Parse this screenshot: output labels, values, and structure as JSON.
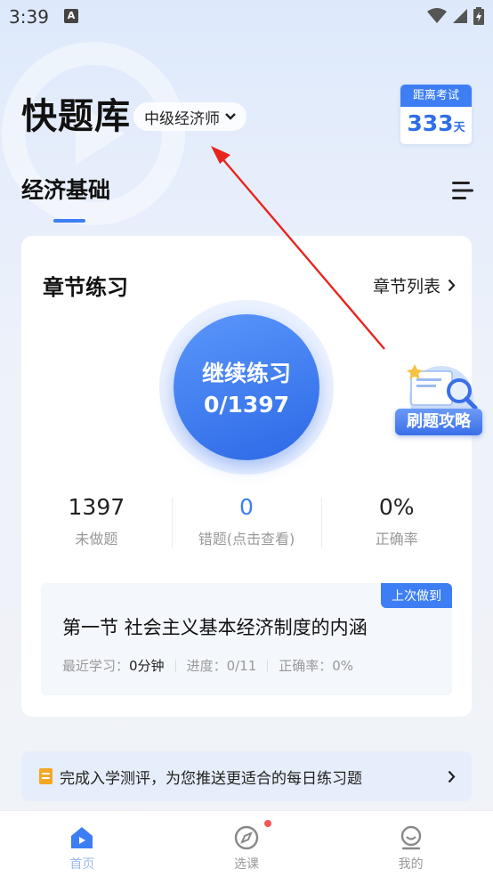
{
  "status": {
    "time": "3:39",
    "app_icon": "A"
  },
  "header": {
    "app_title": "快题库",
    "level": "中级经济师",
    "exam_label": "距离考试",
    "exam_days": "333",
    "exam_unit": "天"
  },
  "subject_tab": "经济基础",
  "chapter": {
    "title": "章节练习",
    "list_link": "章节列表",
    "continue_label": "继续练习",
    "progress": "0/1397",
    "stats": [
      {
        "value": "1397",
        "label": "未做题"
      },
      {
        "value": "0",
        "label": "错题(点击查看)"
      },
      {
        "value": "0%",
        "label": "正确率"
      }
    ],
    "last": {
      "tag": "上次做到",
      "title": "第一节 社会主义基本经济制度的内涵",
      "study_label": "最近学习：",
      "study_value": "0分钟",
      "progress": "进度：0/11",
      "accuracy": "正确率：0%"
    }
  },
  "float_guide": "刷题攻略",
  "banner": {
    "text": "完成入学测评，为您推送更适合的每日练习题"
  },
  "tabs": [
    {
      "label": "首页",
      "icon": "home-icon"
    },
    {
      "label": "选课",
      "icon": "compass-icon"
    },
    {
      "label": "我的",
      "icon": "profile-icon"
    }
  ],
  "colors": {
    "accent": "#3d7ef4",
    "badge_dot": "#f25656",
    "arrow": "#e8241f"
  }
}
